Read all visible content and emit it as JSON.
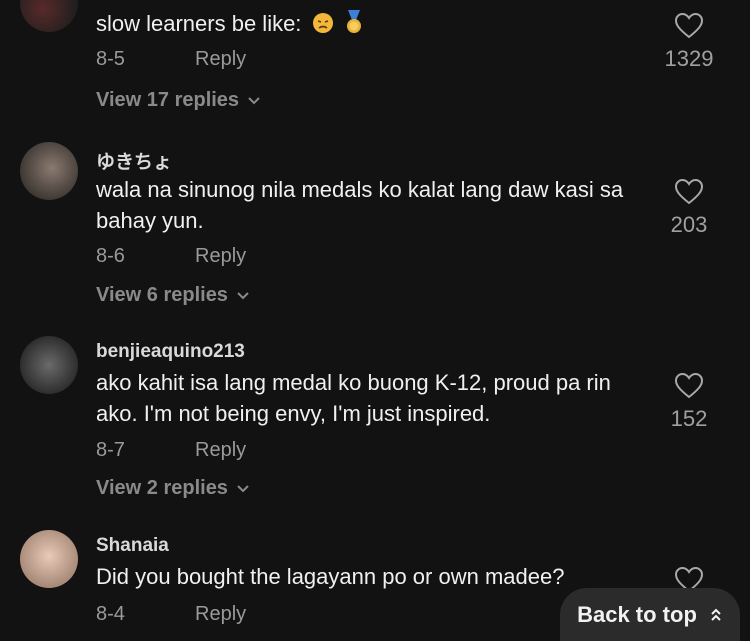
{
  "comments": [
    {
      "username": "",
      "text": "slow learners be like:",
      "emojis": [
        "disappointed-face",
        "sports-medal"
      ],
      "date": "8-5",
      "reply_label": "Reply",
      "likes": "1329",
      "view_replies": "View 17 replies"
    },
    {
      "username": "ゆきちょ",
      "text": "wala na sinunog nila medals ko kalat lang daw kasi sa bahay yun.",
      "date": "8-6",
      "reply_label": "Reply",
      "likes": "203",
      "view_replies": "View 6 replies"
    },
    {
      "username": "benjieaquino213",
      "text": "ako kahit isa lang medal ko buong K-12, proud pa rin ako. I'm not being envy, I'm just inspired.",
      "date": "8-7",
      "reply_label": "Reply",
      "likes": "152",
      "view_replies": "View 2 replies"
    },
    {
      "username": "Shanaia",
      "text": "Did you bought the lagayann po or own madee?",
      "date": "8-4",
      "reply_label": "Reply"
    }
  ],
  "back_to_top": "Back to top",
  "colors": {
    "background": "#121212",
    "text": "#f0f0f0",
    "muted": "#9a9a9a",
    "button_bg": "#2b2b2b"
  }
}
